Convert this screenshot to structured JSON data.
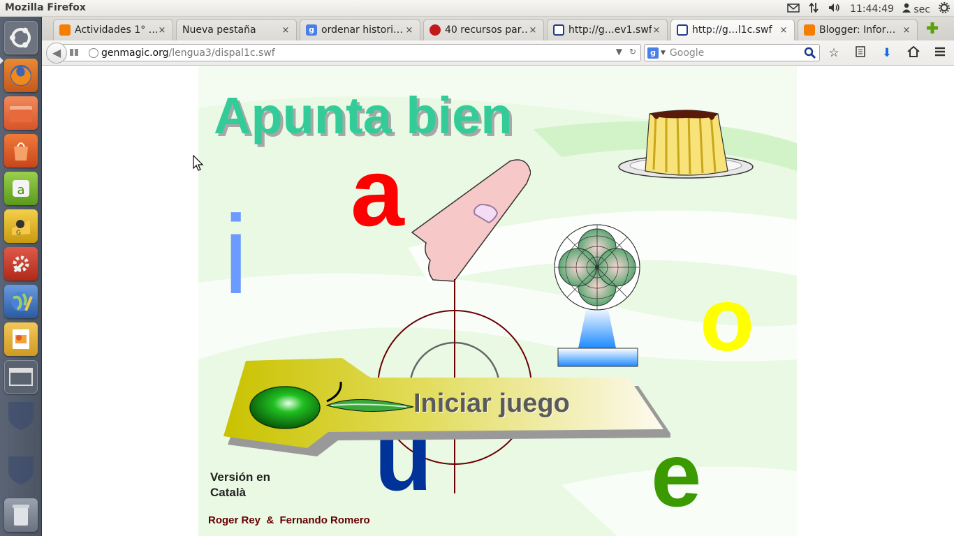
{
  "system": {
    "app_title": "Mozilla Firefox",
    "clock": "11:44:49",
    "user": "sec",
    "tray_icons": [
      "mail-icon",
      "network-arrows-icon",
      "volume-icon",
      "user-icon",
      "power-gear-icon"
    ]
  },
  "launcher": {
    "items": [
      "ubuntu-dash",
      "firefox",
      "files",
      "software-center",
      "text-editor",
      "game-app",
      "system-settings",
      "web-browser",
      "impress-presentation",
      "workspace-switcher",
      "trash"
    ]
  },
  "tabs": [
    {
      "label": "Actividades 1° …",
      "icon": "blogger-icon",
      "active": false
    },
    {
      "label": "Nueva pestaña",
      "icon": "none",
      "active": false
    },
    {
      "label": "ordenar histori…",
      "icon": "google-icon",
      "active": false
    },
    {
      "label": "40 recursos par…",
      "icon": "apple-icon",
      "active": false
    },
    {
      "label": "http://g…ev1.swf",
      "icon": "grid-icon",
      "active": false
    },
    {
      "label": "http://g…l1c.swf",
      "icon": "grid-icon",
      "active": true
    },
    {
      "label": "Blogger: Infor…",
      "icon": "blogger-icon",
      "active": false
    }
  ],
  "tab_close": "×",
  "navbar": {
    "url_host": "genmagic.org",
    "url_path": "/lengua3/dispal1c.swf",
    "search_placeholder": "Google"
  },
  "game": {
    "title": "Apunta bien",
    "letters": {
      "a": "a",
      "i": "i",
      "o": "o",
      "u": "u",
      "e": "e"
    },
    "start_button": "Iniciar juego",
    "version_line1": "Versión en",
    "version_line2": "Català",
    "authors": "Roger Rey  &  Fernando Romero",
    "colors": {
      "a": "#ff0000",
      "i": "#6b9bff",
      "o": "#ffff00",
      "u": "#003399",
      "e": "#3a9a00",
      "title": "#33cc99",
      "authors": "#660000"
    }
  }
}
